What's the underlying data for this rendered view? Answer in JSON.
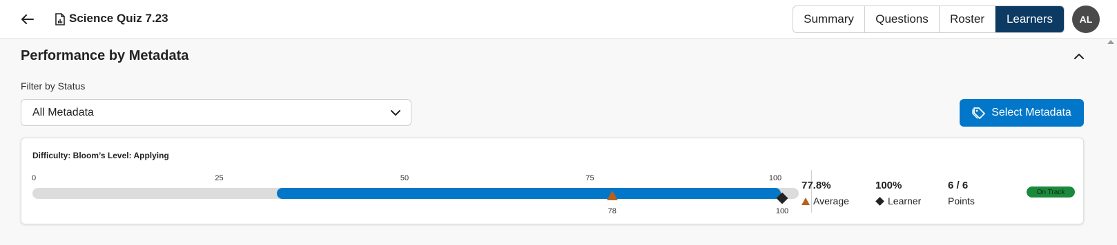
{
  "header": {
    "back_icon": "arrow-left-icon",
    "doc_icon": "report-document-icon",
    "title": "Science Quiz 7.23",
    "tabs": [
      {
        "label": "Summary",
        "active": false
      },
      {
        "label": "Questions",
        "active": false
      },
      {
        "label": "Roster",
        "active": false
      },
      {
        "label": "Learners",
        "active": true
      }
    ],
    "avatar_initials": "AL"
  },
  "section": {
    "title": "Performance by Metadata",
    "collapse_icon": "chevron-up-icon",
    "filter_label": "Filter by Status",
    "filter_value": "All Metadata",
    "filter_icon": "chevron-down-icon",
    "select_metadata_label": "Select Metadata",
    "select_metadata_icon": "tag-icon"
  },
  "card": {
    "title": "Difficulty: Bloom’s Level: Applying",
    "scale_ticks": [
      "0",
      "25",
      "50",
      "75",
      "100"
    ],
    "range_start": 33.5,
    "range_end": 100,
    "average_value": 78,
    "average_label": "78",
    "learner_value": 100,
    "learner_label": "100",
    "stats": {
      "average_value": "77.8%",
      "average_label": "Average",
      "learner_value": "100%",
      "learner_label": "Learner",
      "points_value": "6 / 6",
      "points_label": "Points"
    },
    "status_badge": "On Track"
  },
  "colors": {
    "accent": "#0277c9",
    "active_tab": "#0c3a63",
    "average_marker": "#b8611c",
    "learner_marker": "#222222",
    "badge": "#1a8a3a"
  }
}
